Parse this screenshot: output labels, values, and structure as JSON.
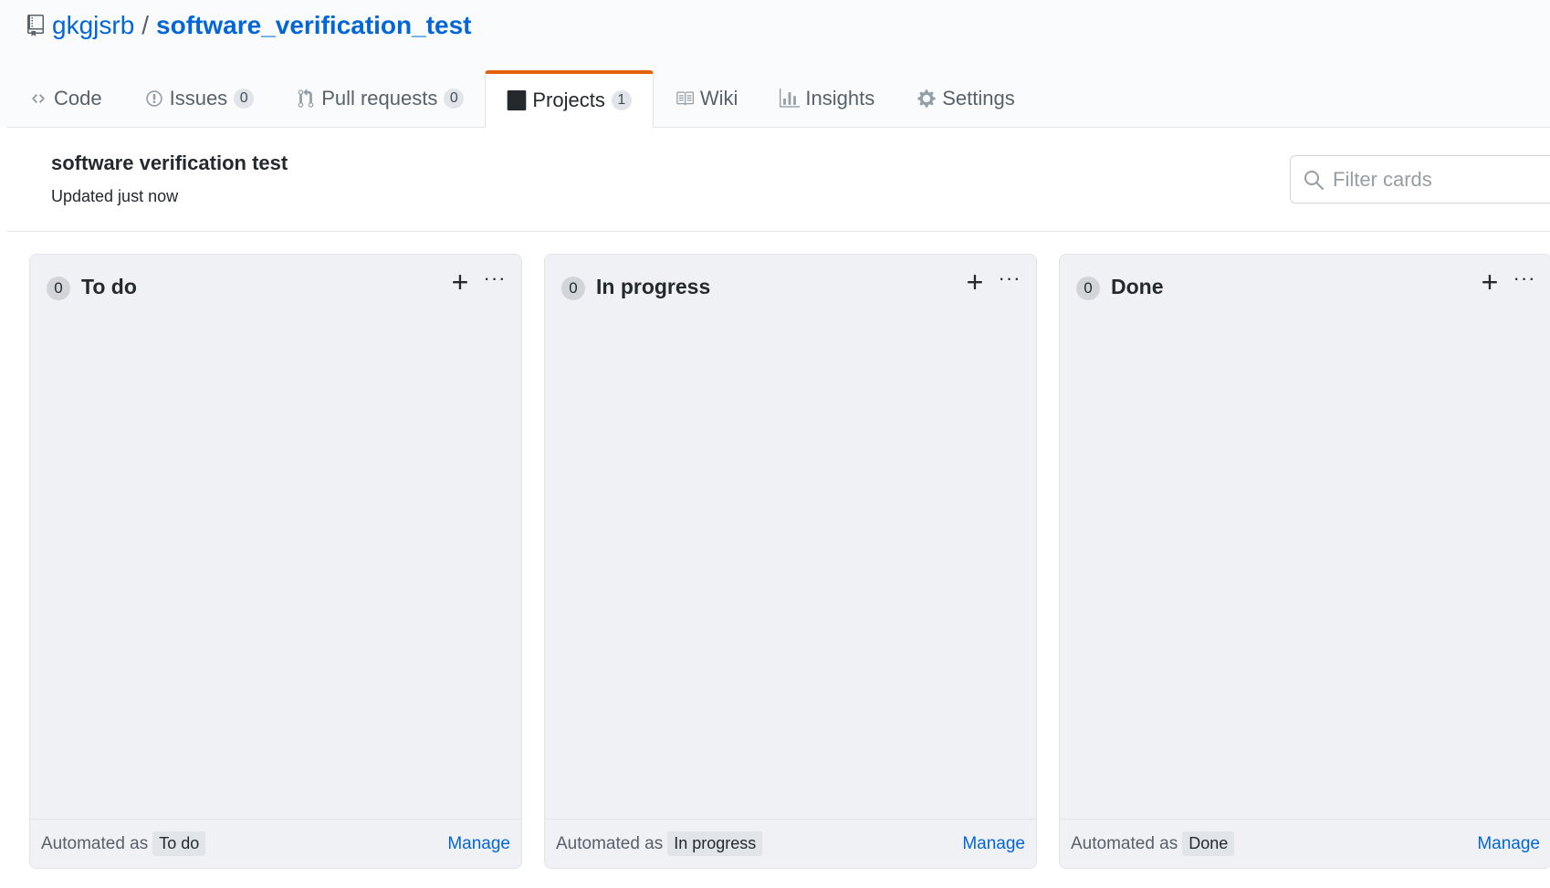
{
  "repo": {
    "owner": "gkgjsrb",
    "separator": "/",
    "name": "software_verification_test"
  },
  "tabs": [
    {
      "label": "Code",
      "icon": "code-icon",
      "count": null
    },
    {
      "label": "Issues",
      "icon": "issue-icon",
      "count": "0"
    },
    {
      "label": "Pull requests",
      "icon": "pull-request-icon",
      "count": "0"
    },
    {
      "label": "Projects",
      "icon": "project-icon",
      "count": "1",
      "selected": true
    },
    {
      "label": "Wiki",
      "icon": "book-icon",
      "count": null
    },
    {
      "label": "Insights",
      "icon": "graph-icon",
      "count": null
    },
    {
      "label": "Settings",
      "icon": "gear-icon",
      "count": null
    }
  ],
  "project": {
    "name": "software verification test",
    "updated": "Updated just now"
  },
  "filter": {
    "placeholder": "Filter cards"
  },
  "columns": [
    {
      "name": "To do",
      "count": "0",
      "automated_label": "Automated as",
      "automated_value": "To do",
      "manage": "Manage"
    },
    {
      "name": "In progress",
      "count": "0",
      "automated_label": "Automated as",
      "automated_value": "In progress",
      "manage": "Manage"
    },
    {
      "name": "Done",
      "count": "0",
      "automated_label": "Automated as",
      "automated_value": "Done",
      "manage": "Manage"
    }
  ],
  "colors": {
    "link": "#0366d6",
    "selected_tab_accent": "#e36209",
    "column_bg": "#eff1f5"
  }
}
